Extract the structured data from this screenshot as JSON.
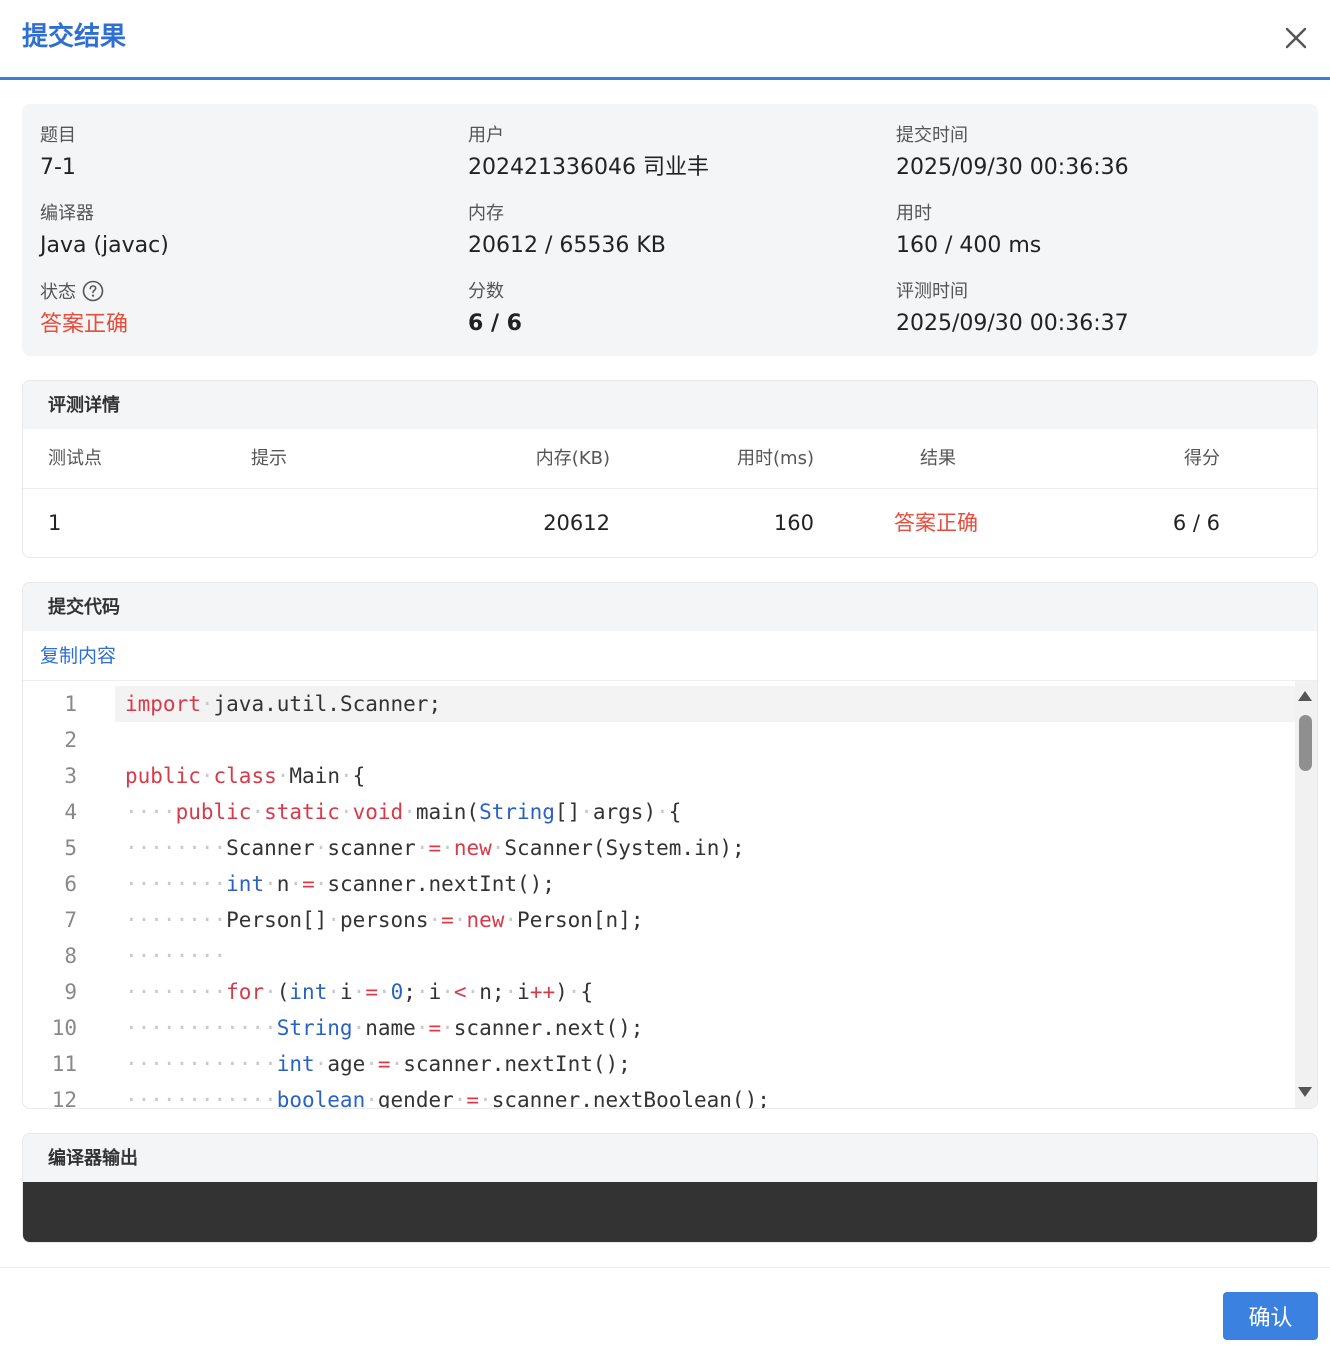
{
  "dialog": {
    "title": "提交结果",
    "confirm_label": "确认"
  },
  "info": {
    "problem_label": "题目",
    "problem_value": "7-1",
    "user_label": "用户",
    "user_value": "202421336046 司业丰",
    "submit_time_label": "提交时间",
    "submit_time_value": "2025/09/30 00:36:36",
    "compiler_label": "编译器",
    "compiler_value": "Java (javac)",
    "memory_label": "内存",
    "memory_value": "20612 / 65536 KB",
    "time_label": "用时",
    "time_value": "160 / 400 ms",
    "status_label": "状态",
    "status_value": "答案正确",
    "score_label": "分数",
    "score_value": "6 / 6",
    "judge_time_label": "评测时间",
    "judge_time_value": "2025/09/30 00:36:37"
  },
  "judge": {
    "title": "评测详情",
    "columns": [
      "测试点",
      "提示",
      "内存(KB)",
      "用时(ms)",
      "结果",
      "得分"
    ],
    "rows": [
      {
        "case": "1",
        "hint": "",
        "memory": "20612",
        "time": "160",
        "result": "答案正确",
        "score": "6 / 6"
      }
    ]
  },
  "code": {
    "title": "提交代码",
    "copy_label": "复制内容",
    "line_numbers": [
      "1",
      "2",
      "3",
      "4",
      "5",
      "6",
      "7",
      "8",
      "9",
      "10",
      "11",
      "12"
    ],
    "lines": [
      "import java.util.Scanner;",
      "",
      "public class Main {",
      "    public static void main(String[] args) {",
      "        Scanner scanner = new Scanner(System.in);",
      "        int n = scanner.nextInt();",
      "        Person[] persons = new Person[n];",
      "        ",
      "        for (int i = 0; i < n; i++) {",
      "            String name = scanner.next();",
      "            int age = scanner.nextInt();",
      "            boolean gender = scanner.nextBoolean();"
    ]
  },
  "compiler_output": {
    "title": "编译器输出",
    "text": ""
  },
  "colors": {
    "accent": "#3b7dd8",
    "status_red": "#e74c3c",
    "keyword": "#d73a49",
    "type": "#2962c0"
  }
}
